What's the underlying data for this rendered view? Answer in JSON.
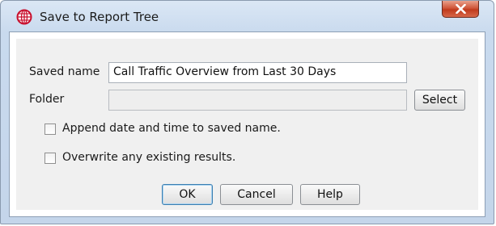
{
  "window": {
    "title": "Save to Report Tree",
    "app_icon": "globe-icon",
    "close_icon": "close-icon"
  },
  "form": {
    "saved_name_label": "Saved name",
    "saved_name_value": "Call Traffic Overview from Last 30 Days",
    "folder_label": "Folder",
    "folder_value": "",
    "select_button": "Select",
    "append_checkbox_label": "Append date and time to saved name.",
    "append_checked": false,
    "overwrite_checkbox_label": "Overwrite any existing results.",
    "overwrite_checked": false
  },
  "buttons": {
    "ok": "OK",
    "cancel": "Cancel",
    "help": "Help"
  },
  "colors": {
    "title_bar": "#c9daee",
    "close_button": "#c9462a",
    "app_icon": "#c8102e",
    "default_button_border": "#3c7fb1"
  }
}
